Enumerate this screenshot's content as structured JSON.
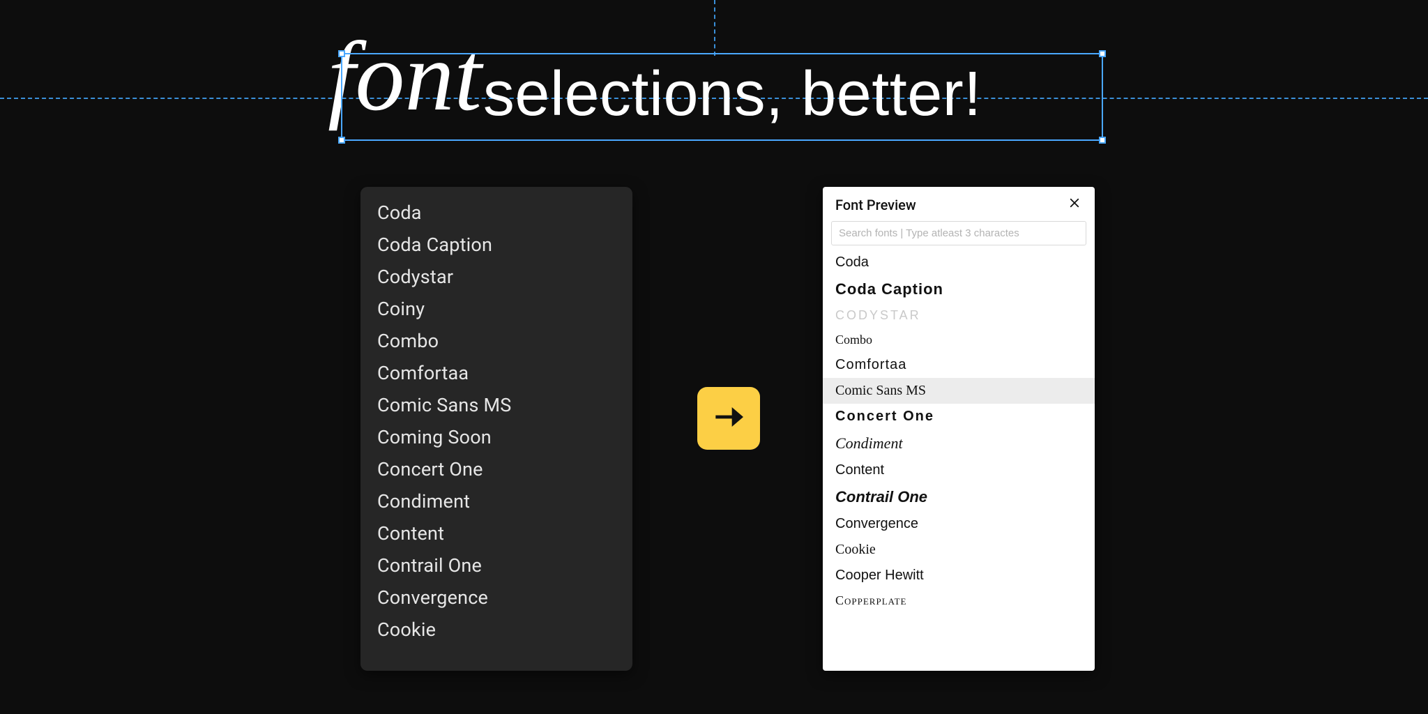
{
  "title": {
    "script": "font",
    "rest": "selections, better!"
  },
  "colors": {
    "accent_blue": "#4aa8ff",
    "arrow_bg": "#fccf45",
    "arrow_fg": "#111111"
  },
  "left_panel": {
    "items": [
      "Coda",
      "Coda Caption",
      "Codystar",
      "Coiny",
      "Combo",
      "Comfortaa",
      "Comic Sans MS",
      "Coming Soon",
      "Concert One",
      "Condiment",
      "Content",
      "Contrail One",
      "Convergence",
      "Cookie"
    ]
  },
  "right_panel": {
    "title": "Font Preview",
    "search_placeholder": "Search fonts | Type atleast 3 charactes",
    "selected_index": 5,
    "items": [
      {
        "label": "Coda",
        "style": "sty-coda"
      },
      {
        "label": "Coda Caption",
        "style": "sty-codacaption"
      },
      {
        "label": "CODYSTAR",
        "style": "sty-codystar"
      },
      {
        "label": "Combo",
        "style": "sty-combo"
      },
      {
        "label": "Comfortaa",
        "style": "sty-comfortaa"
      },
      {
        "label": "Comic Sans MS",
        "style": "sty-comicsans"
      },
      {
        "label": "Concert One",
        "style": "sty-concertone"
      },
      {
        "label": "Condiment",
        "style": "sty-condiment"
      },
      {
        "label": "Content",
        "style": "sty-content"
      },
      {
        "label": "Contrail One",
        "style": "sty-contrailone"
      },
      {
        "label": "Convergence",
        "style": "sty-convergence"
      },
      {
        "label": "Cookie",
        "style": "sty-cookie"
      },
      {
        "label": "Cooper Hewitt",
        "style": "sty-cooperhewitt"
      },
      {
        "label": "Copperplate",
        "style": "sty-copperplate"
      }
    ]
  }
}
